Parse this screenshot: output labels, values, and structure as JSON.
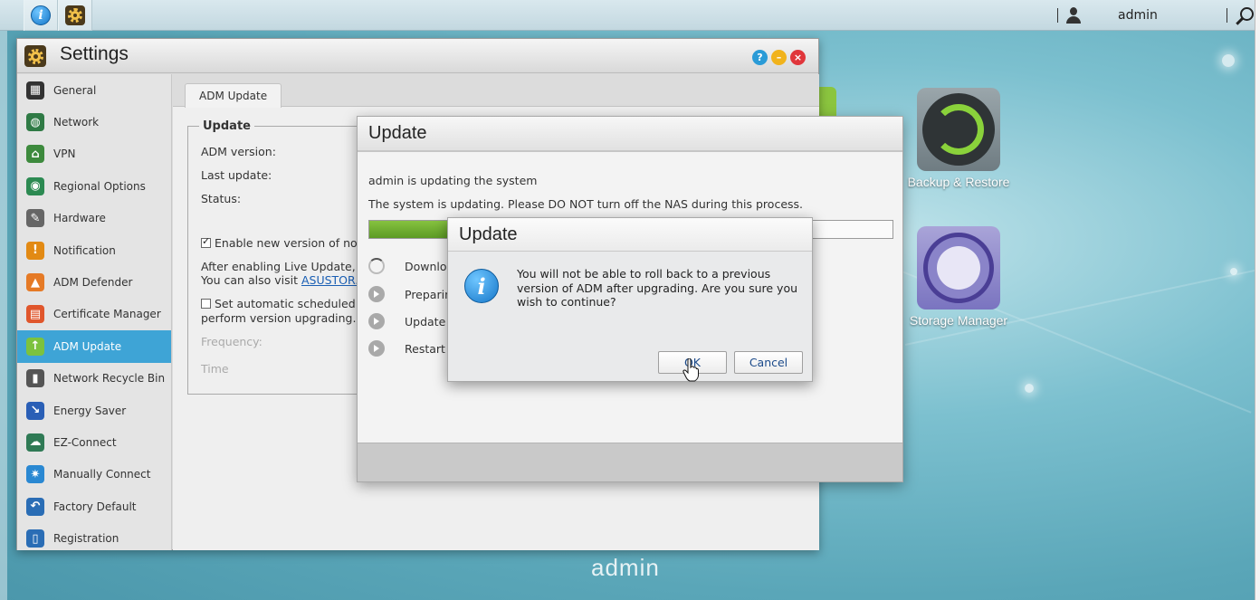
{
  "taskbar": {
    "apps": [
      {
        "icon": "info-icon",
        "active": true
      },
      {
        "icon": "settings-gear-icon",
        "active": true
      }
    ],
    "user": "admin",
    "icons": {
      "user": "user-icon",
      "search": "search-icon"
    }
  },
  "desktop": {
    "icons": [
      {
        "label": "Backup & Restore",
        "icon": "backup-restore-icon"
      },
      {
        "label": "Storage Manager",
        "icon": "storage-manager-icon"
      }
    ],
    "user_label": "admin"
  },
  "settings": {
    "title": "Settings",
    "sidebar": [
      {
        "label": "General",
        "icon": "general-icon",
        "color": "#333333"
      },
      {
        "label": "Network",
        "icon": "network-globe-icon",
        "color": "#2f7a45"
      },
      {
        "label": "VPN",
        "icon": "vpn-icon",
        "color": "#3d8a3d"
      },
      {
        "label": "Regional Options",
        "icon": "regional-globe-icon",
        "color": "#2c8a52"
      },
      {
        "label": "Hardware",
        "icon": "hardware-wrench-icon",
        "color": "#666666"
      },
      {
        "label": "Notification",
        "icon": "notification-icon",
        "color": "#e28a14"
      },
      {
        "label": "ADM Defender",
        "icon": "adm-defender-icon",
        "color": "#e57a26"
      },
      {
        "label": "Certificate Manager",
        "icon": "certificate-icon",
        "color": "#e0562c"
      },
      {
        "label": "ADM Update",
        "icon": "adm-update-arrow-icon",
        "color": "#7cc23e",
        "active": true
      },
      {
        "label": "Network Recycle Bin",
        "icon": "recycle-bin-icon",
        "color": "#555555"
      },
      {
        "label": "Energy Saver",
        "icon": "energy-saver-icon",
        "color": "#2a5fb6"
      },
      {
        "label": "EZ-Connect",
        "icon": "ez-connect-cloud-icon",
        "color": "#2f7a55"
      },
      {
        "label": "Manually Connect",
        "icon": "manually-connect-icon",
        "color": "#2a88d2"
      },
      {
        "label": "Factory Default",
        "icon": "factory-default-icon",
        "color": "#2a6db5"
      },
      {
        "label": "Registration",
        "icon": "registration-icon",
        "color": "#2a6db5"
      }
    ],
    "tab": "ADM Update",
    "section": {
      "legend": "Update",
      "adm_version_label": "ADM version:",
      "last_update_label": "Last update:",
      "status_label": "Status:",
      "enable_live_update": "Enable new version of not",
      "live_update_text_1": "After enabling Live Update, t",
      "live_update_text_2": "You can also visit ",
      "live_update_link": "ASUSTOR.",
      "scheduled_text_1": "Set automatic scheduled",
      "scheduled_text_2": "perform version upgrading.)",
      "frequency_label": "Frequency:",
      "time_label": "Time"
    }
  },
  "update_dialog": {
    "title": "Update",
    "line1": "admin is updating the system",
    "line2": "The system is updating. Please DO NOT turn off the NAS during this process.",
    "progress": 0.15,
    "steps": [
      {
        "label": "Downloa",
        "state": "in-progress"
      },
      {
        "label": "Preparin",
        "state": "pending"
      },
      {
        "label": "Update",
        "state": "pending"
      },
      {
        "label": "Restart",
        "state": "pending"
      }
    ]
  },
  "confirm_dialog": {
    "title": "Update",
    "message": "You will not be able to roll back to a previous version of ADM after upgrading. Are you sure you wish to continue?",
    "ok_label": "OK",
    "cancel_label": "Cancel",
    "icon": "info-icon"
  },
  "colors": {
    "accent": "#3ea4d6",
    "progress": "#6aab2e"
  }
}
